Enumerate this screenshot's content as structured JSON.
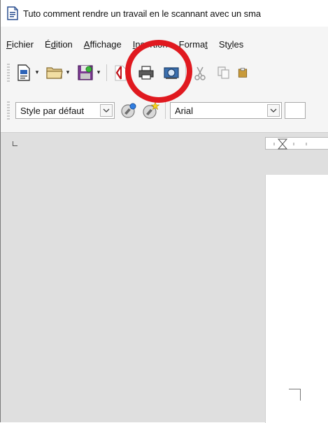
{
  "window": {
    "title": "Tuto comment rendre un travail en le scannant avec un sma"
  },
  "menubar": {
    "items": [
      {
        "pre": "",
        "ul": "F",
        "post": "ichier"
      },
      {
        "pre": "É",
        "ul": "d",
        "post": "ition"
      },
      {
        "pre": "",
        "ul": "A",
        "post": "ffichage"
      },
      {
        "pre": "",
        "ul": "I",
        "post": "nsertion"
      },
      {
        "pre": "Forma",
        "ul": "t",
        "post": ""
      },
      {
        "pre": "St",
        "ul": "y",
        "post": "les"
      }
    ]
  },
  "toolbar": {
    "icons": [
      "new-document-icon",
      "open-folder-icon",
      "save-icon",
      "export-pdf-icon",
      "print-icon",
      "print-preview-icon",
      "cut-icon",
      "copy-icon",
      "paste-icon"
    ]
  },
  "formatting": {
    "paragraph_style": "Style par défaut",
    "font_name": "Arial"
  },
  "colors": {
    "accent_highlight": "#e0191f",
    "pdf_red": "#c0121a",
    "workspace": "#dfdfdf"
  }
}
